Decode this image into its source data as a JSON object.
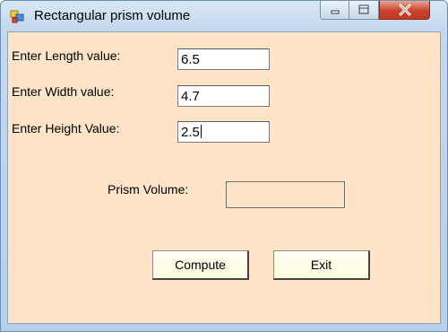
{
  "window": {
    "title": "Rectangular prism volume",
    "icon": "winforms-app-icon"
  },
  "form": {
    "length": {
      "label": "Enter Length value:",
      "value": "6.5"
    },
    "width": {
      "label": "Enter Width value:",
      "value": "4.7"
    },
    "height": {
      "label": "Enter Height Value:",
      "value": "2.5"
    },
    "volume": {
      "label": "Prism Volume:",
      "value": ""
    }
  },
  "buttons": {
    "compute": "Compute",
    "exit": "Exit"
  },
  "colors": {
    "client_background": "#ffe4c8",
    "button_face": "#fffbe0",
    "close_button": "#c9432d"
  }
}
